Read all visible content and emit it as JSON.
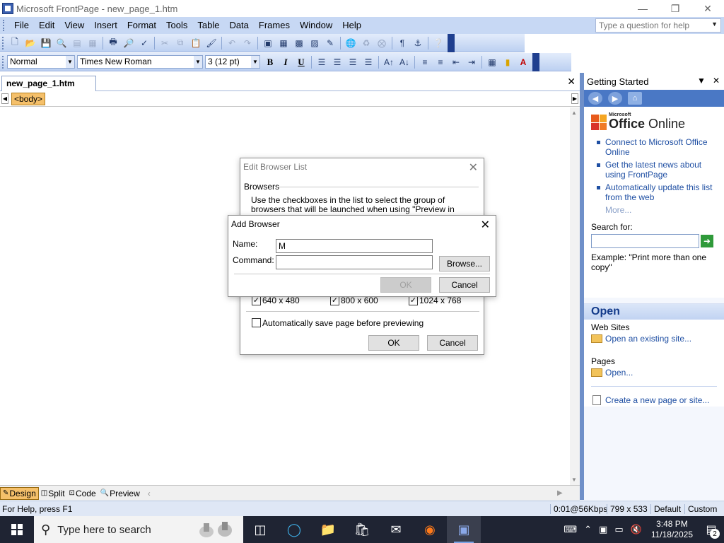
{
  "window": {
    "title": "Microsoft FrontPage - new_page_1.htm",
    "minimize_icon": "minimize-icon",
    "restore_icon": "restore-icon",
    "close_icon": "close-icon"
  },
  "menubar": {
    "items": [
      "File",
      "Edit",
      "View",
      "Insert",
      "Format",
      "Tools",
      "Table",
      "Data",
      "Frames",
      "Window",
      "Help"
    ],
    "help_placeholder": "Type a question for help"
  },
  "formatting": {
    "style": "Normal",
    "font": "Times New Roman",
    "size": "3  (12 pt)",
    "bold": "B",
    "italic": "I",
    "underline": "U"
  },
  "document": {
    "tab_label": "new_page_1.htm",
    "tag": "<body>"
  },
  "view_tabs": {
    "design": "Design",
    "split": "Split",
    "code": "Code",
    "preview": "Preview",
    "active": "Design"
  },
  "statusbar": {
    "help": "For Help, press F1",
    "speed": "0:01@56Kbps",
    "size": "799 x 533",
    "mode1": "Default",
    "mode2": "Custom"
  },
  "taskpane": {
    "title": "Getting Started",
    "logo_small": "Microsoft",
    "logo_office": "Office",
    "logo_online": " Online",
    "links": [
      "Connect to Microsoft Office Online",
      "Get the latest news about using FrontPage",
      "Automatically update this list from the web"
    ],
    "more": "More...",
    "search_label": "Search for:",
    "search_value": "",
    "example": "Example:  \"Print more than one copy\"",
    "open_title": "Open",
    "web_sites_label": "Web Sites",
    "open_site": "Open an existing site...",
    "pages_label": "Pages",
    "open_page": "Open...",
    "new_page": "Create a new page or site..."
  },
  "edit_browser_list": {
    "title": "Edit Browser List",
    "group_label": "Browsers",
    "description": "Use the checkboxes in the list to select the group of browsers that will be launched when using \"Preview in Multiple Browsers\"",
    "resolutions": [
      {
        "label": "640 x 480",
        "checked": true
      },
      {
        "label": "800 x 600",
        "checked": true
      },
      {
        "label": "1024 x 768",
        "checked": true
      }
    ],
    "autosave_label": "Automatically save page before previewing",
    "autosave_checked": false,
    "ok": "OK",
    "cancel": "Cancel"
  },
  "add_browser": {
    "title": "Add Browser",
    "name_label": "Name:",
    "name_value": "M",
    "command_label": "Command:",
    "command_value": "",
    "browse": "Browse...",
    "ok": "OK",
    "cancel": "Cancel"
  },
  "taskbar": {
    "search_placeholder": "Type here to search",
    "apps": [
      "task-view-icon",
      "edge-icon",
      "file-explorer-icon",
      "store-icon",
      "mail-icon",
      "firefox-icon",
      "frontpage-icon"
    ],
    "time": "3:48 PM",
    "date": "11/18/2025",
    "notification_count": "2"
  }
}
